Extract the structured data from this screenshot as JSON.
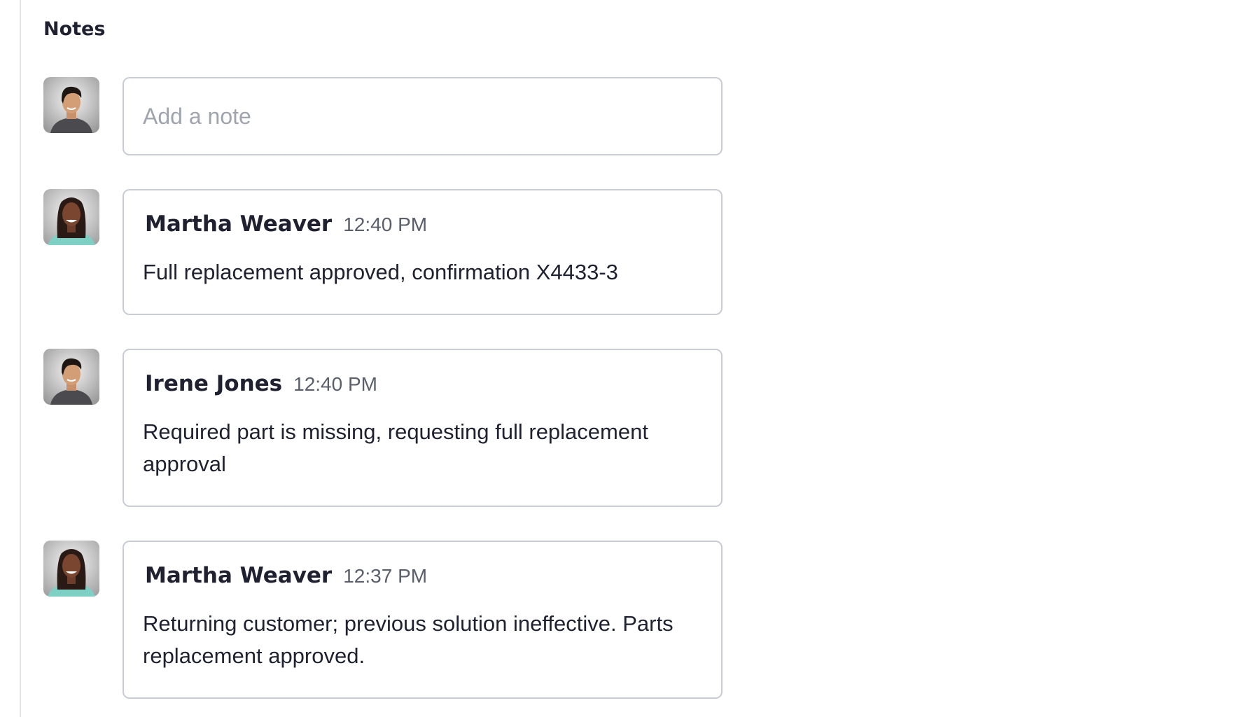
{
  "notes_panel": {
    "title": "Notes",
    "input": {
      "placeholder": "Add a note",
      "value": ""
    },
    "items": [
      {
        "author": "Martha Weaver",
        "time": "12:40 PM",
        "text": "Full replacement approved, confirmation X4433-3",
        "avatar": "martha-avatar"
      },
      {
        "author": "Irene Jones",
        "time": "12:40 PM",
        "text": "Required part is missing, requesting full replacement approval",
        "avatar": "irene-avatar"
      },
      {
        "author": "Martha Weaver",
        "time": "12:37 PM",
        "text": "Returning customer; previous solution ineffective. Parts replacement approved.",
        "avatar": "martha-avatar"
      }
    ]
  },
  "colors": {
    "text": "#1f2130",
    "muted": "#5b5f6b",
    "border": "#c9ccd3",
    "placeholder": "#a0a4ad"
  }
}
